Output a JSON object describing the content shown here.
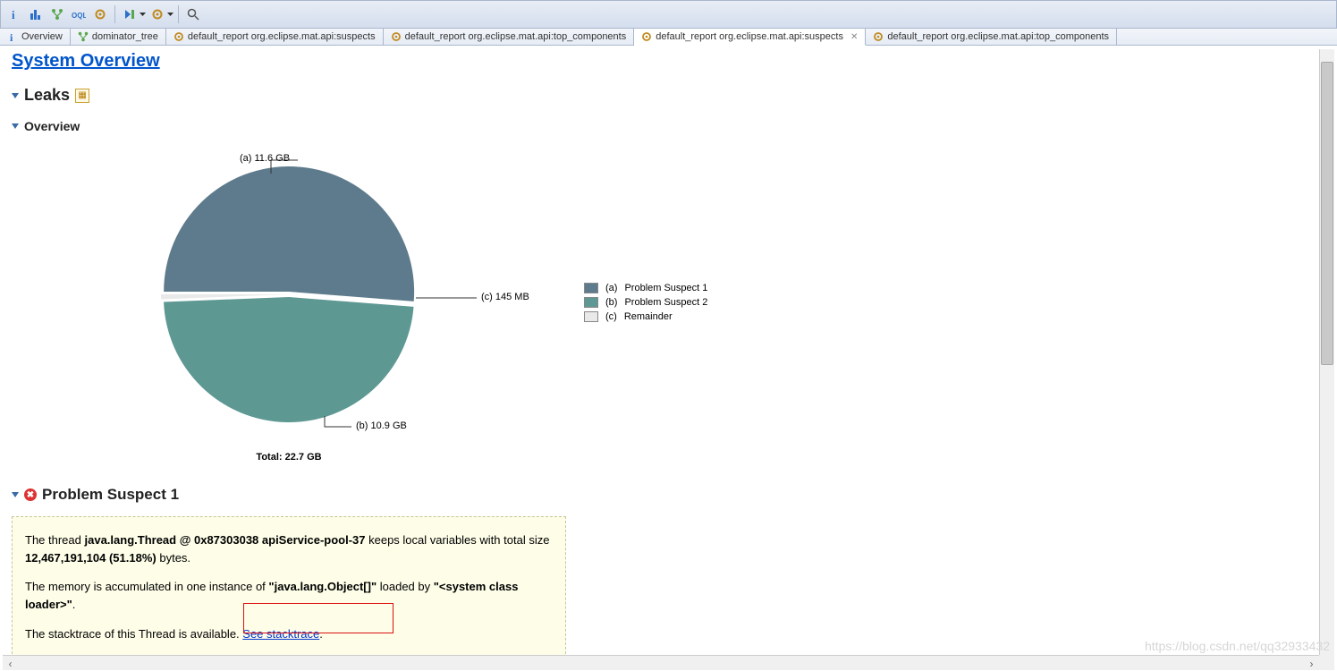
{
  "tabs": [
    {
      "label": "Overview",
      "icon": "info"
    },
    {
      "label": "dominator_tree",
      "icon": "tree"
    },
    {
      "label": "default_report  org.eclipse.mat.api:suspects",
      "icon": "gear"
    },
    {
      "label": "default_report  org.eclipse.mat.api:top_components",
      "icon": "gear"
    },
    {
      "label": "default_report  org.eclipse.mat.api:suspects",
      "icon": "gear",
      "active": true
    },
    {
      "label": "default_report  org.eclipse.mat.api:top_components",
      "icon": "gear"
    }
  ],
  "page_title": "System Overview",
  "leaks_heading": "Leaks",
  "overview_heading": "Overview",
  "suspect_heading": "Problem Suspect 1",
  "chart_data": {
    "type": "pie",
    "total_label": "Total: 22.7 GB",
    "callouts": [
      {
        "key": "a",
        "text": "(a) 11.6 GB"
      },
      {
        "key": "b",
        "text": "(b) 10.9 GB"
      },
      {
        "key": "c",
        "text": "(c) 145 MB"
      }
    ],
    "slices": [
      {
        "key": "a",
        "label": "Problem Suspect 1",
        "value_gb": 11.6,
        "color": "#5d7b8c"
      },
      {
        "key": "b",
        "label": "Problem Suspect 2",
        "value_gb": 10.9,
        "color": "#5e9893"
      },
      {
        "key": "c",
        "label": "Remainder",
        "value_gb": 0.1416,
        "color": "#e9e9e9"
      }
    ],
    "legend": [
      {
        "letter": "(a)",
        "label": "Problem Suspect 1",
        "color": "#5d7b8c"
      },
      {
        "letter": "(b)",
        "label": "Problem Suspect 2",
        "color": "#5e9893"
      },
      {
        "letter": "(c)",
        "label": "Remainder",
        "color": "#e9e9e9"
      }
    ]
  },
  "suspect": {
    "intro1": "The thread ",
    "thread": "java.lang.Thread @ 0x87303038 apiService-pool-37",
    "intro2": " keeps local variables with total size ",
    "size": "12,467,191,104 (51.18%)",
    "intro3": " bytes.",
    "p2a": "The memory is accumulated in one instance of ",
    "class": "\"java.lang.Object[]\"",
    "p2b": " loaded by ",
    "loader": "\"<system class loader>\"",
    "p2c": ".",
    "p3": "The stacktrace of this Thread is available. ",
    "link": "See stacktrace",
    "dot": "."
  },
  "watermark": "https://blog.csdn.net/qq32933432"
}
